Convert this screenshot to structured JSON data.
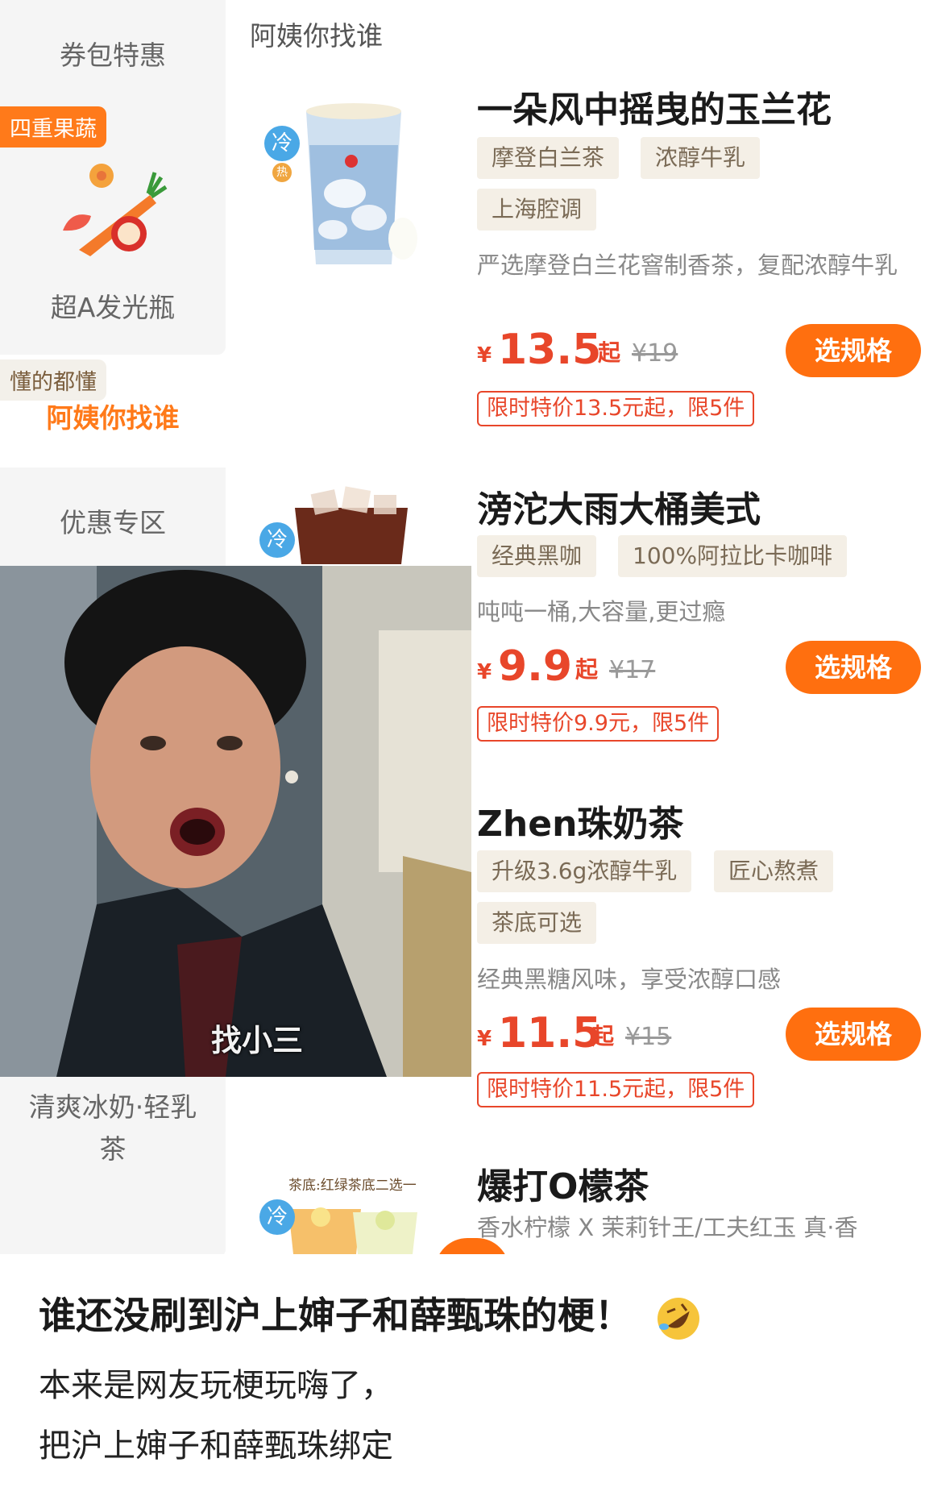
{
  "sidebar": {
    "categories": [
      {
        "label": "券包特惠"
      },
      {
        "badge": "四重果蔬",
        "label": "超A发光瓶"
      },
      {
        "badge": "懂的都懂",
        "label": "阿姨你找谁"
      },
      {
        "label": "优惠专区"
      },
      {
        "label": "清爽冰奶·轻乳茶"
      }
    ]
  },
  "section": {
    "title": "阿姨你找谁"
  },
  "products": [
    {
      "name": "一朵风中摇曳的玉兰花",
      "tags": [
        "摩登白兰茶",
        "浓醇牛乳",
        "上海腔调"
      ],
      "desc": "严选摩登白兰花窨制香茶，复配浓醇牛乳",
      "currency": "¥",
      "price": "13.5",
      "from": "起",
      "old_price": "¥19",
      "button": "选规格",
      "promo": "限时特价13.5元起，限5件",
      "temp_cold": "冷",
      "temp_hot": "热"
    },
    {
      "name": "滂沱大雨大桶美式",
      "tags": [
        "经典黑咖",
        "100%阿拉比卡咖啡"
      ],
      "desc": "吨吨一桶,大容量,更过瘾",
      "currency": "¥",
      "price": "9.9",
      "from": "起",
      "old_price": "¥17",
      "button": "选规格",
      "promo": "限时特价9.9元，限5件",
      "temp_cold": "冷"
    },
    {
      "name": "Zhen珠奶茶",
      "tags": [
        "升级3.6g浓醇牛乳",
        "匠心熬煮",
        "茶底可选"
      ],
      "desc": "经典黑糖风味，享受浓醇口感",
      "currency": "¥",
      "price": "11.5",
      "from": "起",
      "old_price": "¥15",
      "button": "选规格",
      "promo": "限时特价11.5元起，限5件"
    },
    {
      "name": "爆打O檬茶",
      "desc": "香水柠檬 X 茉莉针王/工夫红玉 真·香",
      "img_caption": "茶底:红绿茶底二选一",
      "temp_cold": "冷"
    }
  ],
  "meme": {
    "caption": "找小三"
  },
  "post": {
    "title": "谁还没刷到沪上婶子和薛甄珠的梗！",
    "emoji": "rolling-on-floor-laughing-emoji",
    "lines": [
      "本来是网友玩梗玩嗨了，",
      "把沪上婶子和薛甄珠绑定"
    ]
  },
  "colors": {
    "accent": "#ff6f0f",
    "price": "#e8462a",
    "tag_bg": "#f4efe6",
    "cold": "#4aa8e6"
  }
}
